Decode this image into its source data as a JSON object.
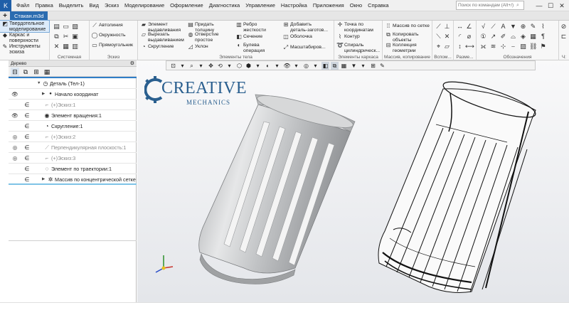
{
  "window": {
    "app_icon": "kompas-logo-icon",
    "menu": [
      "Файл",
      "Правка",
      "Выделить",
      "Вид",
      "Эскиз",
      "Моделирование",
      "Оформление",
      "Диагностика",
      "Управление",
      "Настройка",
      "Приложения",
      "Окно",
      "Справка"
    ],
    "search_placeholder": "Поиск по командам (Alt+/)",
    "controls": {
      "minimize": "—",
      "maximize": "☐",
      "close": "✕"
    }
  },
  "document": {
    "tab": "Стакан.m3d",
    "new_tab": "+"
  },
  "ribbon": {
    "modes": [
      {
        "label1": "Твердотельное",
        "label2": "моделирование",
        "active": true
      },
      {
        "label1": "Каркас и",
        "label2": "поверхности",
        "active": false
      },
      {
        "label1": "Инструменты",
        "label2": "эскиза",
        "active": false
      }
    ],
    "groups": {
      "system": "Системная",
      "sketch": "Эскиз",
      "body": "Элементы тела",
      "frame": "Элементы каркаса",
      "array": "Массив, копирование",
      "aux": "Вспом...",
      "size": "Разме...",
      "marks": "Обозначения",
      "ch": "Ч:"
    },
    "sketch_buttons": [
      "Автолиния",
      "Окружность",
      "Прямоугольник"
    ],
    "body_buttons": {
      "extrude": [
        "Элемент",
        "выдавливания"
      ],
      "cut": [
        "Вырезать",
        "выдавливанием"
      ],
      "fillet": [
        "Скругление"
      ],
      "thickness": [
        "Придать",
        "толщину"
      ],
      "hole": [
        "Отверстие",
        "простое"
      ],
      "slope": [
        "Уклон"
      ],
      "rib": [
        "Ребро",
        "жесткости"
      ],
      "section": [
        "Сечение"
      ],
      "boolean": [
        "Булева",
        "операция"
      ],
      "add_part": [
        "Добавить",
        "деталь-заготов..."
      ],
      "shell": [
        "Оболочка"
      ],
      "scale": [
        "Масштабиров..."
      ]
    },
    "frame_buttons": {
      "point": [
        "Точка по",
        "координатам"
      ],
      "contour": [
        "Контур"
      ],
      "spiral": [
        "Спираль",
        "цилиндрическ..."
      ]
    },
    "array_buttons": {
      "grid": [
        "Массив по сетке"
      ],
      "copy": [
        "Копировать",
        "объекты"
      ],
      "collection": [
        "Коллекция",
        "геометрии"
      ]
    }
  },
  "tree": {
    "header": "Дерево",
    "rows": [
      {
        "label": "Деталь (Тел-1)",
        "dim": false,
        "eye": "",
        "link": "",
        "icon": "part-icon"
      },
      {
        "label": "Начало координат",
        "dim": false,
        "eye": "👁",
        "link": "",
        "icon": "origin-icon"
      },
      {
        "label": "(+)Эскиз:1",
        "dim": true,
        "eye": "",
        "link": "∈",
        "icon": "sketch-icon"
      },
      {
        "label": "Элемент вращения:1",
        "dim": false,
        "eye": "👁",
        "link": "∈",
        "icon": "rotation-icon"
      },
      {
        "label": "Скругление:1",
        "dim": false,
        "eye": "",
        "link": "∈",
        "icon": "fillet-icon"
      },
      {
        "label": "(+)Эскиз:2",
        "dim": true,
        "eye": "◎",
        "link": "∈",
        "icon": "sketch-icon"
      },
      {
        "label": "Перпендикулярная плоскость:1",
        "dim": true,
        "eye": "◎",
        "link": "∈",
        "icon": "plane-icon"
      },
      {
        "label": "(+)Эскиз:3",
        "dim": true,
        "eye": "◎",
        "link": "∈",
        "icon": "sketch-icon"
      },
      {
        "label": "Элемент по траектории:1",
        "dim": false,
        "eye": "",
        "link": "∈",
        "icon": "sweep-icon"
      },
      {
        "label": "Массив по концентрической сетке",
        "dim": false,
        "eye": "",
        "link": "∈",
        "icon": "array-icon"
      }
    ]
  },
  "watermark": {
    "main": "CREATIVE",
    "sub": "MECHANICS"
  },
  "colors": {
    "accent": "#2b6cb0",
    "logo": "#2a5f8f",
    "selection": "#2f7ec7"
  }
}
